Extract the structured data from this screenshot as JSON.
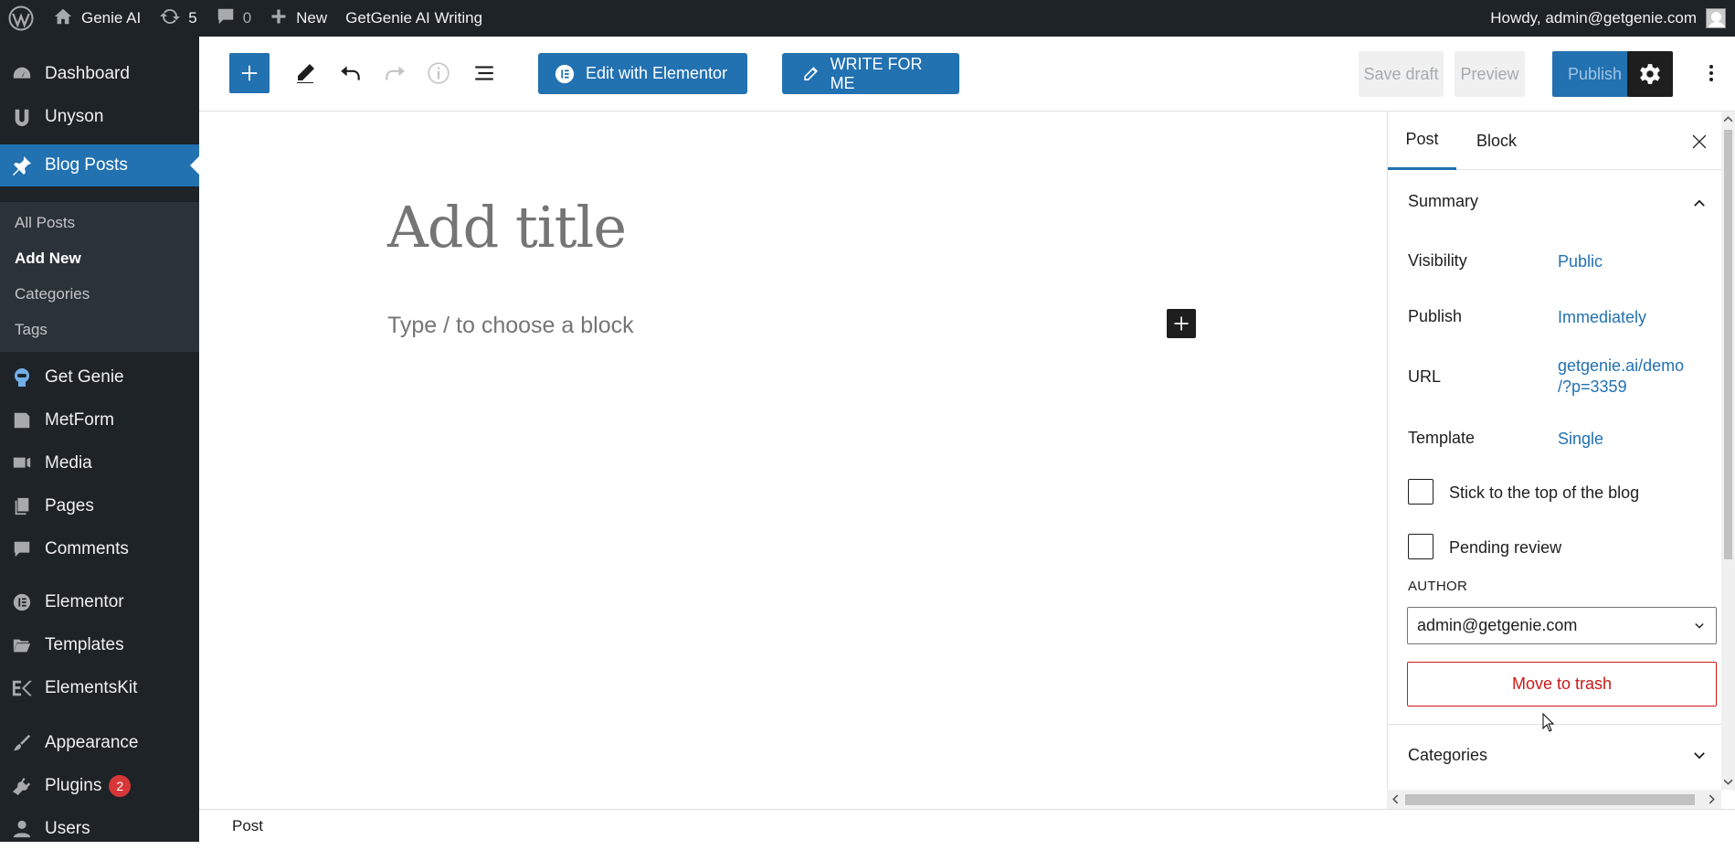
{
  "adminbar": {
    "site_name": "Genie AI",
    "updates_count": "5",
    "comments_count": "0",
    "new_label": "New",
    "plugin_link": "GetGenie AI Writing",
    "greeting": "Howdy, admin@getgenie.com"
  },
  "sidebar": {
    "dashboard": "Dashboard",
    "unyson": "Unyson",
    "blog_posts": "Blog Posts",
    "sub": {
      "all_posts": "All Posts",
      "add_new": "Add New",
      "categories": "Categories",
      "tags": "Tags"
    },
    "get_genie": "Get Genie",
    "metform": "MetForm",
    "media": "Media",
    "pages": "Pages",
    "comments": "Comments",
    "elementor": "Elementor",
    "templates": "Templates",
    "elementskit": "ElementsKit",
    "appearance": "Appearance",
    "plugins": "Plugins",
    "plugins_badge": "2",
    "users": "Users"
  },
  "toolbar": {
    "edit_elementor": "Edit with Elementor",
    "write_for_me": "WRITE FOR ME",
    "save_draft": "Save draft",
    "preview": "Preview",
    "publish": "Publish"
  },
  "editor": {
    "title_placeholder": "Add title",
    "block_placeholder": "Type / to choose a block"
  },
  "panel": {
    "tab_post": "Post",
    "tab_block": "Block",
    "summary": "Summary",
    "visibility_label": "Visibility",
    "visibility_value": "Public",
    "publish_label": "Publish",
    "publish_value": "Immediately",
    "url_label": "URL",
    "url_value_line1": "getgenie.ai/demo",
    "url_value_line2": "/?p=3359",
    "template_label": "Template",
    "template_value": "Single",
    "sticky_label": "Stick to the top of the blog",
    "pending_label": "Pending review",
    "author_label": "AUTHOR",
    "author_value": "admin@getgenie.com",
    "trash": "Move to trash",
    "categories": "Categories"
  },
  "footer": {
    "breadcrumb": "Post"
  },
  "colors": {
    "admin_dark": "#1d2327",
    "accent": "#2271b1",
    "danger": "#cc1818"
  }
}
